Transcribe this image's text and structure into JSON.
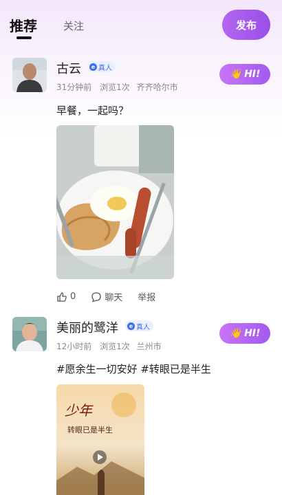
{
  "header": {
    "tab_recommend": "推荐",
    "tab_follow": "关注",
    "publish_label": "发布"
  },
  "posts": [
    {
      "name": "古云",
      "badge": "真人",
      "badge_icon": "e",
      "time": "31分钟前",
      "views": "浏览1次",
      "city": "齐齐哈尔市",
      "hi_label": "HI!",
      "text": "早餐，一起吗？",
      "like_count": "0",
      "chat_label": "聊天",
      "report_label": "举报"
    },
    {
      "name": "美丽的鹭洋",
      "badge": "真人",
      "badge_icon": "e",
      "time": "12小时前",
      "views": "浏览1次",
      "city": "兰州市",
      "hi_label": "HI!",
      "text": "#愿余生一切安好 #转眼已是半生",
      "poster_line1": "少年",
      "poster_line2": "转眼已是半生"
    }
  ],
  "colors": {
    "accent": "#9a4fe8",
    "badge_blue": "#3d6cf0"
  }
}
